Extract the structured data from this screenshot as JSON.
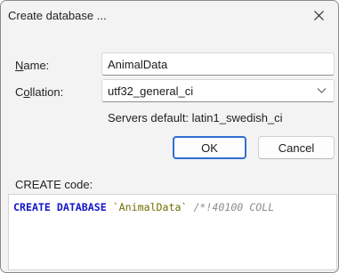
{
  "window": {
    "title": "Create database ..."
  },
  "form": {
    "name_label": "Name:",
    "name_label_mnemonic": "N",
    "name_label_rest": "ame:",
    "name_value": "AnimalData",
    "collation_label_first": "C",
    "collation_label_mnemonic": "o",
    "collation_label_rest": "llation:",
    "collation_value": "utf32_general_ci",
    "server_default_text": "Servers default: latin1_swedish_ci"
  },
  "buttons": {
    "ok_label": "OK",
    "cancel_label": "Cancel"
  },
  "code": {
    "label": "CREATE code:",
    "keyword": "CREATE DATABASE",
    "name_literal": "`AnimalData`",
    "comment": "/*!40100 COLL"
  },
  "icons": {
    "close": "close-icon",
    "dropdown": "chevron-down-icon"
  },
  "colors": {
    "keyword": "#1414c8",
    "identifier": "#6f6f00",
    "comment": "#8c8c8c",
    "primary_border": "#2f6fd1"
  }
}
